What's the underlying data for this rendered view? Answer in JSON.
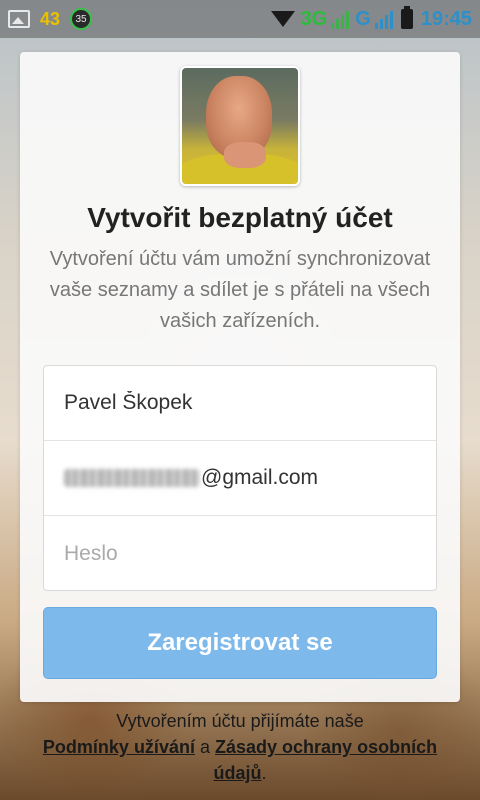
{
  "status_bar": {
    "notification_count": "43",
    "badge_value": "35",
    "network_3g": "3G",
    "network_g": "G",
    "time": "19:45",
    "icons": [
      "gallery-icon",
      "wifi-icon",
      "signal-icon",
      "battery-icon"
    ]
  },
  "card": {
    "title": "Vytvořit bezplatný účet",
    "subtitle": "Vytvoření účtu vám umožní synchronizovat vaše seznamy a sdílet je s přáteli na všech vašich zařízeních.",
    "form": {
      "name_value": "Pavel Škopek",
      "email_suffix": "@gmail.com",
      "password_placeholder": "Heslo"
    },
    "register_label": "Zaregistrovat se"
  },
  "legal": {
    "prefix": "Vytvořením účtu přijímáte naše",
    "terms_link": "Podmínky užívání",
    "and": "a",
    "privacy_link": "Zásady ochrany osobních údajů",
    "suffix": "."
  },
  "colors": {
    "primary_button": "#7db9ea",
    "status_blue": "#2e90c8",
    "status_green": "#2bbd3a"
  }
}
